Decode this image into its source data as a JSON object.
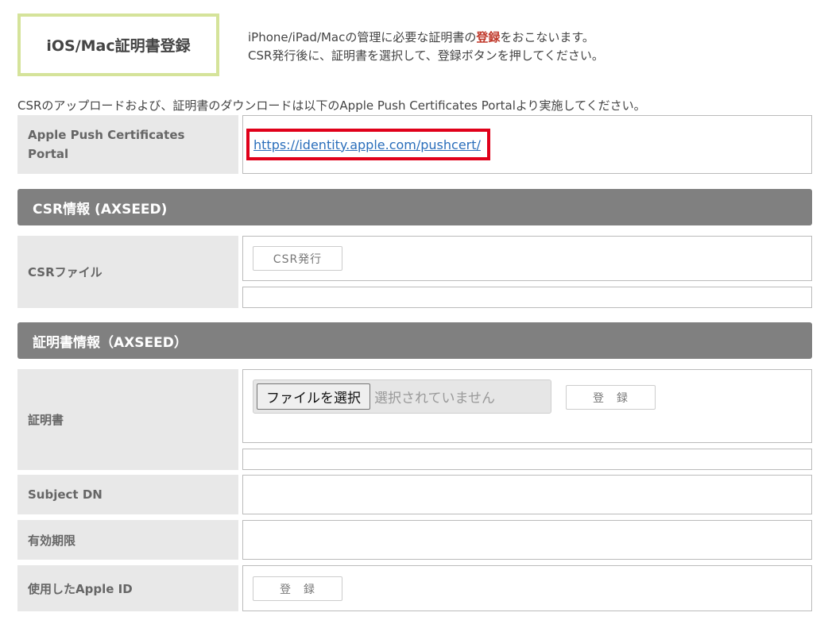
{
  "header": {
    "title": "iOS/Mac証明書登録",
    "intro_line1_pre": "iPhone/iPad/Macの管理に必要な証明書の",
    "intro_line1_highlight": "登録",
    "intro_line1_post": "をおこないます。",
    "intro_line2": "CSR発行後に、証明書を選択して、登録ボタンを押してください。",
    "accent_color": "#d5e39a",
    "highlight_color": "#c0392b"
  },
  "note": "CSRのアップロードおよび、証明書のダウンロードは以下のApple Push Certificates Portalより実施してください。",
  "portal": {
    "label": "Apple Push Certificates Portal",
    "link": "https://identity.apple.com/pushcert/"
  },
  "csr_section": {
    "title": "CSR情報 (AXSEED)",
    "file_label": "CSRファイル",
    "issue_button": "CSR発行"
  },
  "cert_section": {
    "title": "証明書情報（AXSEED）",
    "cert_label": "証明書",
    "choose_file_button": "ファイルを選択",
    "file_status": "選択されていません",
    "register_button": "登　録",
    "subject_dn_label": "Subject DN",
    "expiry_label": "有効期限",
    "apple_id_label": "使用したApple ID",
    "apple_id_button": "登　録"
  }
}
